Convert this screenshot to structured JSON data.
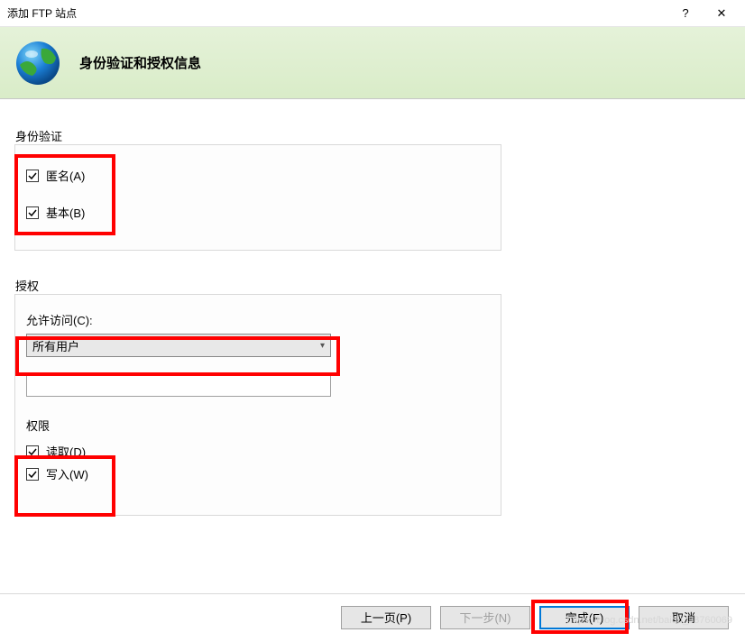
{
  "titlebar": {
    "title": "添加 FTP 站点",
    "help": "?",
    "close": "✕"
  },
  "banner": {
    "title": "身份验证和授权信息"
  },
  "auth": {
    "group_label": "身份验证",
    "anonymous_label": "匿名(A)",
    "basic_label": "基本(B)"
  },
  "authorize": {
    "group_label": "授权",
    "allow_access_label": "允许访问(C):",
    "selected": "所有用户",
    "permissions_label": "权限",
    "read_label": "读取(D)",
    "write_label": "写入(W)"
  },
  "buttons": {
    "prev": "上一页(P)",
    "next": "下一步(N)",
    "finish": "完成(F)",
    "cancel": "取消"
  },
  "watermark": "https://blog.csdn.net/baidu_38760069"
}
